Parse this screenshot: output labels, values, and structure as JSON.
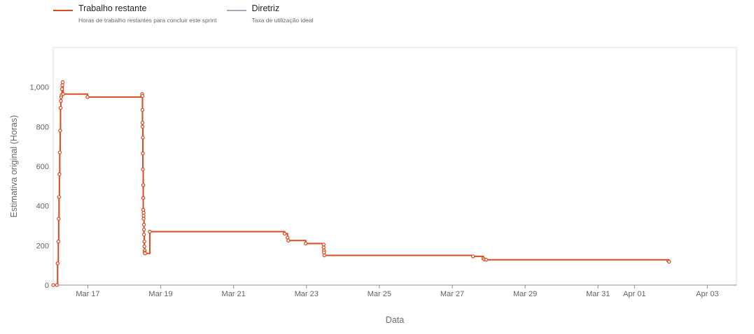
{
  "legend": {
    "items": [
      {
        "name": "Trabalho restante",
        "description": "Horas de trabalho restantes para concluir este sprint",
        "color": "#d74b21"
      },
      {
        "name": "Diretriz",
        "description": "Taxa de utilização ideal",
        "color": "#a6a6b5"
      }
    ]
  },
  "chart_data": {
    "type": "line",
    "xlabel": "Data",
    "ylabel": "Estimativa original (Horas)",
    "x_ticks": [
      "Mar 17",
      "Mar 19",
      "Mar 21",
      "Mar 23",
      "Mar 25",
      "Mar 27",
      "Mar 29",
      "Mar 31",
      "Apr 01",
      "Apr 03"
    ],
    "x_tick_days": [
      17,
      19,
      21,
      23,
      25,
      27,
      29,
      31,
      32,
      34
    ],
    "y_ticks": [
      "0",
      "200",
      "400",
      "600",
      "800",
      "1,000"
    ],
    "y_tick_values": [
      0,
      200,
      400,
      600,
      800,
      1000
    ],
    "xlim": [
      16.05,
      34.8
    ],
    "ylim": [
      0,
      1200
    ],
    "grid": false,
    "legend_position": "top-left",
    "series": [
      {
        "name": "Trabalho restante",
        "color": "#d74b21",
        "step": true,
        "points": [
          [
            16.05,
            0
          ],
          [
            16.15,
            0
          ],
          [
            16.17,
            110
          ],
          [
            16.19,
            220
          ],
          [
            16.2,
            335
          ],
          [
            16.21,
            445
          ],
          [
            16.22,
            560
          ],
          [
            16.23,
            670
          ],
          [
            16.24,
            780
          ],
          [
            16.25,
            895
          ],
          [
            16.26,
            930
          ],
          [
            16.27,
            950
          ],
          [
            16.28,
            960
          ],
          [
            16.29,
            990
          ],
          [
            16.3,
            1010
          ],
          [
            16.31,
            1025
          ],
          [
            16.32,
            965
          ],
          [
            16.99,
            950
          ],
          [
            18.49,
            955
          ],
          [
            18.49,
            965
          ],
          [
            18.5,
            955
          ],
          [
            18.5,
            885
          ],
          [
            18.5,
            820
          ],
          [
            18.5,
            800
          ],
          [
            18.51,
            745
          ],
          [
            18.51,
            665
          ],
          [
            18.51,
            585
          ],
          [
            18.52,
            505
          ],
          [
            18.52,
            440
          ],
          [
            18.52,
            380
          ],
          [
            18.53,
            365
          ],
          [
            18.53,
            350
          ],
          [
            18.53,
            335
          ],
          [
            18.54,
            305
          ],
          [
            18.54,
            280
          ],
          [
            18.54,
            255
          ],
          [
            18.55,
            220
          ],
          [
            18.55,
            195
          ],
          [
            18.56,
            175
          ],
          [
            18.56,
            165
          ],
          [
            18.57,
            160
          ],
          [
            18.7,
            270
          ],
          [
            22.4,
            260
          ],
          [
            22.48,
            240
          ],
          [
            22.5,
            225
          ],
          [
            22.98,
            210
          ],
          [
            23.47,
            205
          ],
          [
            23.47,
            190
          ],
          [
            23.48,
            175
          ],
          [
            23.48,
            165
          ],
          [
            23.49,
            150
          ],
          [
            27.57,
            145
          ],
          [
            27.85,
            135
          ],
          [
            27.88,
            130
          ],
          [
            27.93,
            128
          ],
          [
            32.93,
            122
          ],
          [
            32.95,
            118
          ]
        ]
      },
      {
        "name": "Diretriz",
        "color": "#a6a6b5",
        "points": []
      }
    ]
  }
}
